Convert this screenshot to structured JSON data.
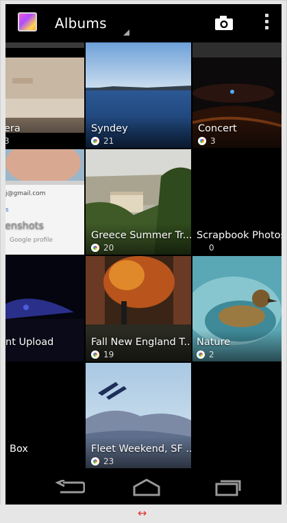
{
  "action_bar": {
    "title": "Albums",
    "app_icon": "gallery-app-icon",
    "camera_icon": "camera-icon",
    "overflow_icon": "overflow-menu-icon"
  },
  "albums": [
    {
      "label": "era",
      "count": "3"
    },
    {
      "label": "Syndey",
      "count": "21"
    },
    {
      "label": "Concert",
      "count": "3"
    },
    {
      "label": "enshots",
      "count": "",
      "preview_text": [
        "j@gmail.com",
        "s",
        "Google profile"
      ]
    },
    {
      "label": "Greece Summer Tr...",
      "count": "20"
    },
    {
      "label": "Scrapbook Photos",
      "count": "0"
    },
    {
      "label": "nt Upload",
      "count": ""
    },
    {
      "label": "Fall New England T...",
      "count": "19"
    },
    {
      "label": "Nature",
      "count": "2"
    },
    {
      "label": "Box",
      "count": ""
    },
    {
      "label": "Fleet Weekend, SF ...",
      "count": "23"
    }
  ],
  "nav_bar": {
    "back_icon": "back-icon",
    "home_icon": "home-icon",
    "recents_icon": "recent-apps-icon"
  },
  "window": {
    "resize_glyph": "↔"
  },
  "colors": {
    "background": "#000000",
    "frame": "#e6e6e6",
    "resize_arrow": "#e0322a"
  }
}
